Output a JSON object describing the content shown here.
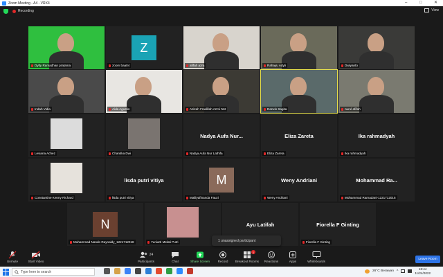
{
  "window": {
    "title": "Zoom Meeting - A4 - VRX4"
  },
  "topbar": {
    "recording_label": "Recording",
    "view_label": "View"
  },
  "participants": [
    {
      "name": "Dylty Ramadhan pratama",
      "kind": "video",
      "bg": "#2fbf3f"
    },
    {
      "name": "zoom baa04",
      "kind": "avatar",
      "initial": "Z",
      "avatar_color": "#1aa3b5"
    },
    {
      "name": "afifah azra",
      "kind": "video",
      "bg": "#d8d4cd"
    },
    {
      "name": "Rahayu Adyti",
      "kind": "video",
      "bg": "#6a6a5a"
    },
    {
      "name": "Dwiyanto",
      "kind": "video",
      "bg": "#3a3a38"
    },
    {
      "name": "Indah Vidia",
      "kind": "video",
      "bg": "#4a4a4a"
    },
    {
      "name": "Aida Agustin",
      "kind": "video",
      "bg": "#e8e6e2"
    },
    {
      "name": "Azizah Fradillah Azmi Nst",
      "kind": "video",
      "bg": "#3c3a34"
    },
    {
      "name": "Darwis Sagita",
      "kind": "video",
      "bg": "#5a6a6a",
      "active": true
    },
    {
      "name": "nurul afifah",
      "kind": "video",
      "bg": "#7a7a70"
    },
    {
      "name": "Leviana Achez",
      "kind": "thumb",
      "bg": "#dcdcdc"
    },
    {
      "name": "Chantika Dwi",
      "kind": "thumb",
      "bg": "#7a7470"
    },
    {
      "name": "Nadya Aufa Nur Lathifa",
      "kind": "name",
      "display": "Nadya  Aufa  Nur..."
    },
    {
      "name": "Eliza Zareta",
      "kind": "name",
      "display": "Eliza Zareta"
    },
    {
      "name": "Ika rahmadyah",
      "kind": "name",
      "display": "Ika rahmadyah"
    },
    {
      "name": "Constantine Kenny Richard",
      "kind": "thumb",
      "bg": "#e6e2dc"
    },
    {
      "name": "lisda putri vitiya",
      "kind": "name",
      "display": "lisda putri vitiya"
    },
    {
      "name": "Mailiyafinanda Fauzi",
      "kind": "avatar",
      "initial": "M",
      "avatar_color": "#8a6a5a"
    },
    {
      "name": "Weny Andriani",
      "kind": "name",
      "display": "Weny Andriani"
    },
    {
      "name": "Mohammad Ramadani-1221712015",
      "kind": "name",
      "display": "Mohammad  Ra..."
    },
    {
      "name": "Muhammad Nando Raynaldy_1221712018",
      "kind": "avatar",
      "initial": "N",
      "avatar_color": "#6a4030"
    },
    {
      "name": "Yuniarti Melati Putri",
      "kind": "thumb",
      "bg": "#c89090"
    },
    {
      "name": "Ayu Latifah",
      "kind": "name",
      "display": "Ayu Latifah"
    },
    {
      "name": "Fiorella F Ginting",
      "kind": "name",
      "display": "Fiorella F Ginting"
    }
  ],
  "popup": {
    "text": "1 unassigned participant"
  },
  "toolbar": {
    "unmute": "Unmute",
    "start_video": "Start Video",
    "participants": "Participants",
    "participants_count": "24",
    "chat": "Chat",
    "share_screen": "Share Screen",
    "record": "Record",
    "breakout": "Breakout Rooms",
    "breakout_badge": "1",
    "reactions": "Reactions",
    "apps": "Apps",
    "whiteboards": "Whiteboards",
    "leave": "Leave Room"
  },
  "taskbar": {
    "search_placeholder": "Type here to search",
    "weather": "26°C  Berawan",
    "time": "18:44",
    "date": "11/24/2022"
  },
  "colors": {
    "accent": "#2d74e8",
    "active_speaker": "#e9e24d",
    "recording": "#e02828",
    "shield": "#23d959"
  }
}
